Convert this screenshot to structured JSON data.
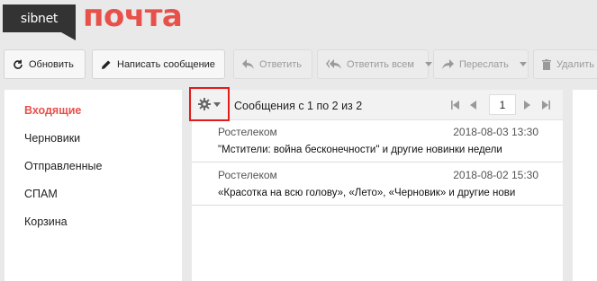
{
  "logo": {
    "brand": "sibnet",
    "title": "почта"
  },
  "toolbar": {
    "refresh": "Обновить",
    "compose": "Написать сообщение",
    "reply": "Ответить",
    "reply_all": "Ответить всем",
    "forward": "Переслать",
    "delete": "Удалить"
  },
  "folders": [
    {
      "label": "Входящие",
      "active": true
    },
    {
      "label": "Черновики",
      "active": false
    },
    {
      "label": "Отправленные",
      "active": false
    },
    {
      "label": "СПАМ",
      "active": false
    },
    {
      "label": "Корзина",
      "active": false
    }
  ],
  "mail_list": {
    "count_text": "Сообщения с 1 по 2 из 2",
    "page": "1",
    "messages": [
      {
        "sender": "Ростелеком",
        "date": "2018-08-03 13:30",
        "subject": "\"Мстители: война бесконечности\" и другие новинки недели"
      },
      {
        "sender": "Ростелеком",
        "date": "2018-08-02 15:30",
        "subject": "«Красотка на всю голову», «Лето», «Черновик» и другие нови"
      }
    ]
  },
  "colors": {
    "accent": "#e8504a",
    "highlight_box": "#e21b1b"
  },
  "icons": {
    "refresh": "refresh-icon",
    "compose": "pencil-icon",
    "reply": "reply-icon",
    "reply_all": "reply-all-icon",
    "forward": "forward-icon",
    "delete": "trash-icon",
    "settings": "gear-icon"
  }
}
